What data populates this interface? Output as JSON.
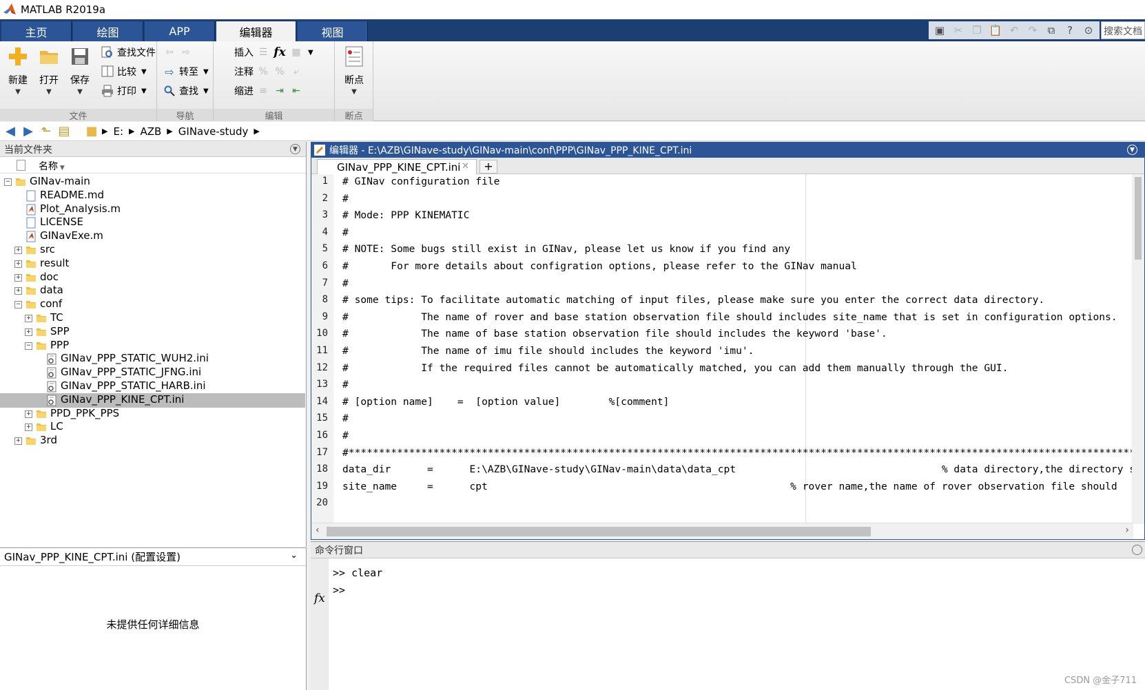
{
  "app": {
    "title": "MATLAB R2019a"
  },
  "ribbon_tabs": [
    {
      "label": "主页"
    },
    {
      "label": "绘图"
    },
    {
      "label": "APP"
    },
    {
      "label": "编辑器"
    },
    {
      "label": "视图"
    }
  ],
  "search_docs": {
    "placeholder": "搜索文档"
  },
  "ribbon": {
    "file": {
      "group_label": "文件",
      "new": "新建",
      "open": "打开",
      "save": "保存",
      "find_files": "查找文件",
      "compare": "比较",
      "print": "打印"
    },
    "navigate": {
      "group_label": "导航",
      "goto": "转至",
      "find": "查找"
    },
    "edit": {
      "group_label": "编辑",
      "insert": "插入",
      "comment": "注释",
      "indent": "缩进"
    },
    "breakpoints": {
      "group_label": "断点",
      "button": "断点"
    }
  },
  "address": {
    "parts": [
      "E:",
      "AZB",
      "GINave-study"
    ]
  },
  "current_folder": {
    "title": "当前文件夹",
    "column_name": "名称",
    "items": [
      {
        "label": "GINav-main",
        "type": "folder",
        "toggle": "−"
      },
      {
        "label": "README.md",
        "type": "file"
      },
      {
        "label": "Plot_Analysis.m",
        "type": "mfile"
      },
      {
        "label": "LICENSE",
        "type": "file"
      },
      {
        "label": "GINavExe.m",
        "type": "mfile"
      },
      {
        "label": "src",
        "type": "folder",
        "toggle": "+"
      },
      {
        "label": "result",
        "type": "folder",
        "toggle": "+"
      },
      {
        "label": "doc",
        "type": "folder",
        "toggle": "+"
      },
      {
        "label": "data",
        "type": "folder",
        "toggle": "+"
      },
      {
        "label": "conf",
        "type": "folder",
        "toggle": "−"
      },
      {
        "label": "TC",
        "type": "folder",
        "toggle": "+"
      },
      {
        "label": "SPP",
        "type": "folder",
        "toggle": "+"
      },
      {
        "label": "PPP",
        "type": "folder",
        "toggle": "−"
      },
      {
        "label": "GINav_PPP_STATIC_WUH2.ini",
        "type": "ini"
      },
      {
        "label": "GINav_PPP_STATIC_JFNG.ini",
        "type": "ini"
      },
      {
        "label": "GINav_PPP_STATIC_HARB.ini",
        "type": "ini"
      },
      {
        "label": "GINav_PPP_KINE_CPT.ini",
        "type": "ini",
        "selected": true
      },
      {
        "label": "PPD_PPK_PPS",
        "type": "folder",
        "toggle": "+"
      },
      {
        "label": "LC",
        "type": "folder",
        "toggle": "+"
      },
      {
        "label": "3rd",
        "type": "folder",
        "toggle": "+"
      }
    ]
  },
  "details": {
    "title": "GINav_PPP_KINE_CPT.ini  (配置设置)",
    "empty": "未提供任何详细信息"
  },
  "editor": {
    "title": "编辑器 - E:\\AZB\\GINave-study\\GINav-main\\conf\\PPP\\GINav_PPP_KINE_CPT.ini",
    "tab_label": "GINav_PPP_KINE_CPT.ini",
    "lines": [
      {
        "n": "1",
        "text": "# GINav configuration file"
      },
      {
        "n": "2",
        "text": "#"
      },
      {
        "n": "3",
        "text": "# Mode: PPP KINEMATIC"
      },
      {
        "n": "4",
        "text": "#"
      },
      {
        "n": "5",
        "text": "# NOTE: Some bugs still exist in GINav, please let us know if you find any"
      },
      {
        "n": "6",
        "text": "#       For more details about configration options, please refer to the GINav manual"
      },
      {
        "n": "7",
        "text": "#"
      },
      {
        "n": "8",
        "text": "# some tips: To facilitate automatic matching of input files, please make sure you enter the correct data directory."
      },
      {
        "n": "9",
        "text": "#            The name of rover and base station observation file should includes site_name that is set in configuration options."
      },
      {
        "n": "10",
        "text": "#            The name of base station observation file should includes the keyword 'base'."
      },
      {
        "n": "11",
        "text": "#            The name of imu file should includes the keyword 'imu'."
      },
      {
        "n": "12",
        "text": "#            If the required files cannot be automatically matched, you can add them manually through the GUI."
      },
      {
        "n": "13",
        "text": "#"
      },
      {
        "n": "14",
        "text": "# [option name]    =  [option value]        %[comment]"
      },
      {
        "n": "15",
        "text": "#"
      },
      {
        "n": "16",
        "text": "#"
      },
      {
        "n": "17",
        "text": "#****************************************************************************************************************************************************"
      },
      {
        "n": "18",
        "text": "data_dir      =      E:\\AZB\\GINave-study\\GINav-main\\data\\data_cpt                                  % data directory,the directory sh"
      },
      {
        "n": "19",
        "text": "site_name     =      cpt                                                  % rover name,the name of rover observation file should"
      },
      {
        "n": "20",
        "text": ""
      }
    ]
  },
  "command_window": {
    "title": "命令行窗口",
    "lines": [
      ">> clear",
      ">>"
    ]
  },
  "watermark": "CSDN @金子711"
}
